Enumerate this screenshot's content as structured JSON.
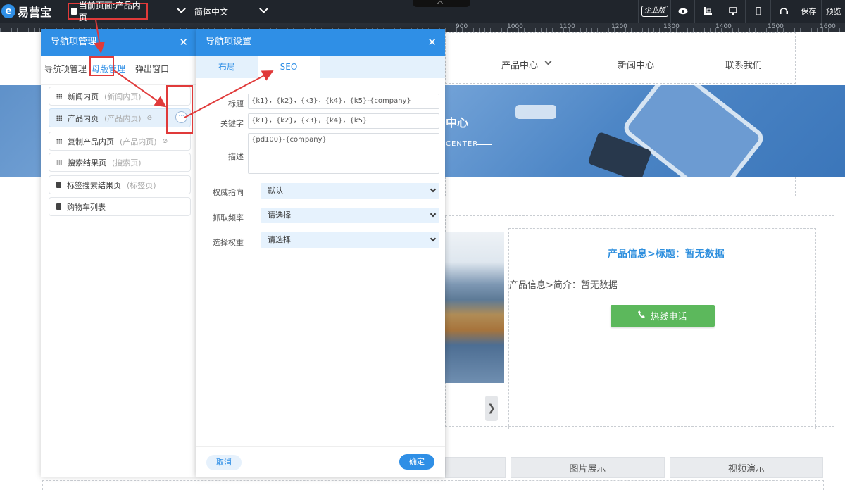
{
  "toolbar": {
    "logo_text": "易营宝",
    "current_page": "当前页面:产品内页",
    "language": "简体中文",
    "edition": "企业版",
    "save": "保存",
    "preview": "预览",
    "icons": [
      "eye-icon",
      "ruler-icon",
      "desktop-icon",
      "mobile-icon",
      "support-icon"
    ]
  },
  "ruler": {
    "labels": [
      "900",
      "1000",
      "1100",
      "1200",
      "1300",
      "1400",
      "1500",
      "1600"
    ]
  },
  "site": {
    "nav": [
      "产品中心",
      "新闻中心",
      "联系我们"
    ],
    "banner_title": "中心",
    "banner_subtitle": "CENTER",
    "product_title": "产品信息>标题：暂无数据",
    "product_brief": "产品信息>简介：暂无数据",
    "hotline": "热线电话",
    "tabs": [
      "图片展示",
      "视频演示"
    ],
    "arrow": "❯"
  },
  "nav_manager": {
    "title": "导航项管理",
    "tabs": [
      "导航项管理",
      "母版管理",
      "弹出窗口"
    ],
    "items": [
      {
        "label": "新闻内页",
        "sub": "(新闻内页)"
      },
      {
        "label": "产品内页",
        "sub": "(产品内页)"
      },
      {
        "label": "复制产品内页",
        "sub": "(产品内页)"
      },
      {
        "label": "搜索结果页",
        "sub": "(搜索页)"
      },
      {
        "label": "标签搜索结果页",
        "sub": "(标签页)"
      },
      {
        "label": "购物车列表",
        "sub": ""
      }
    ],
    "more": "···"
  },
  "nav_settings": {
    "title": "导航项设置",
    "tabs": [
      "布局",
      "SEO"
    ],
    "active_tab": "SEO",
    "fields": {
      "title_label": "标题",
      "title_value": "{k1}，{k2}，{k3}，{k4}，{k5}-{company}",
      "keywords_label": "关键字",
      "keywords_value": "{k1}，{k2}，{k3}，{k4}，{k5}",
      "desc_label": "描述",
      "desc_value": "{pd100}-{company}",
      "authority_label": "权威指向",
      "authority_value": "默认",
      "freq_label": "抓取频率",
      "freq_value": "请选择",
      "weight_label": "选择权重",
      "weight_value": "请选择"
    },
    "cancel": "取消",
    "ok": "确定"
  }
}
